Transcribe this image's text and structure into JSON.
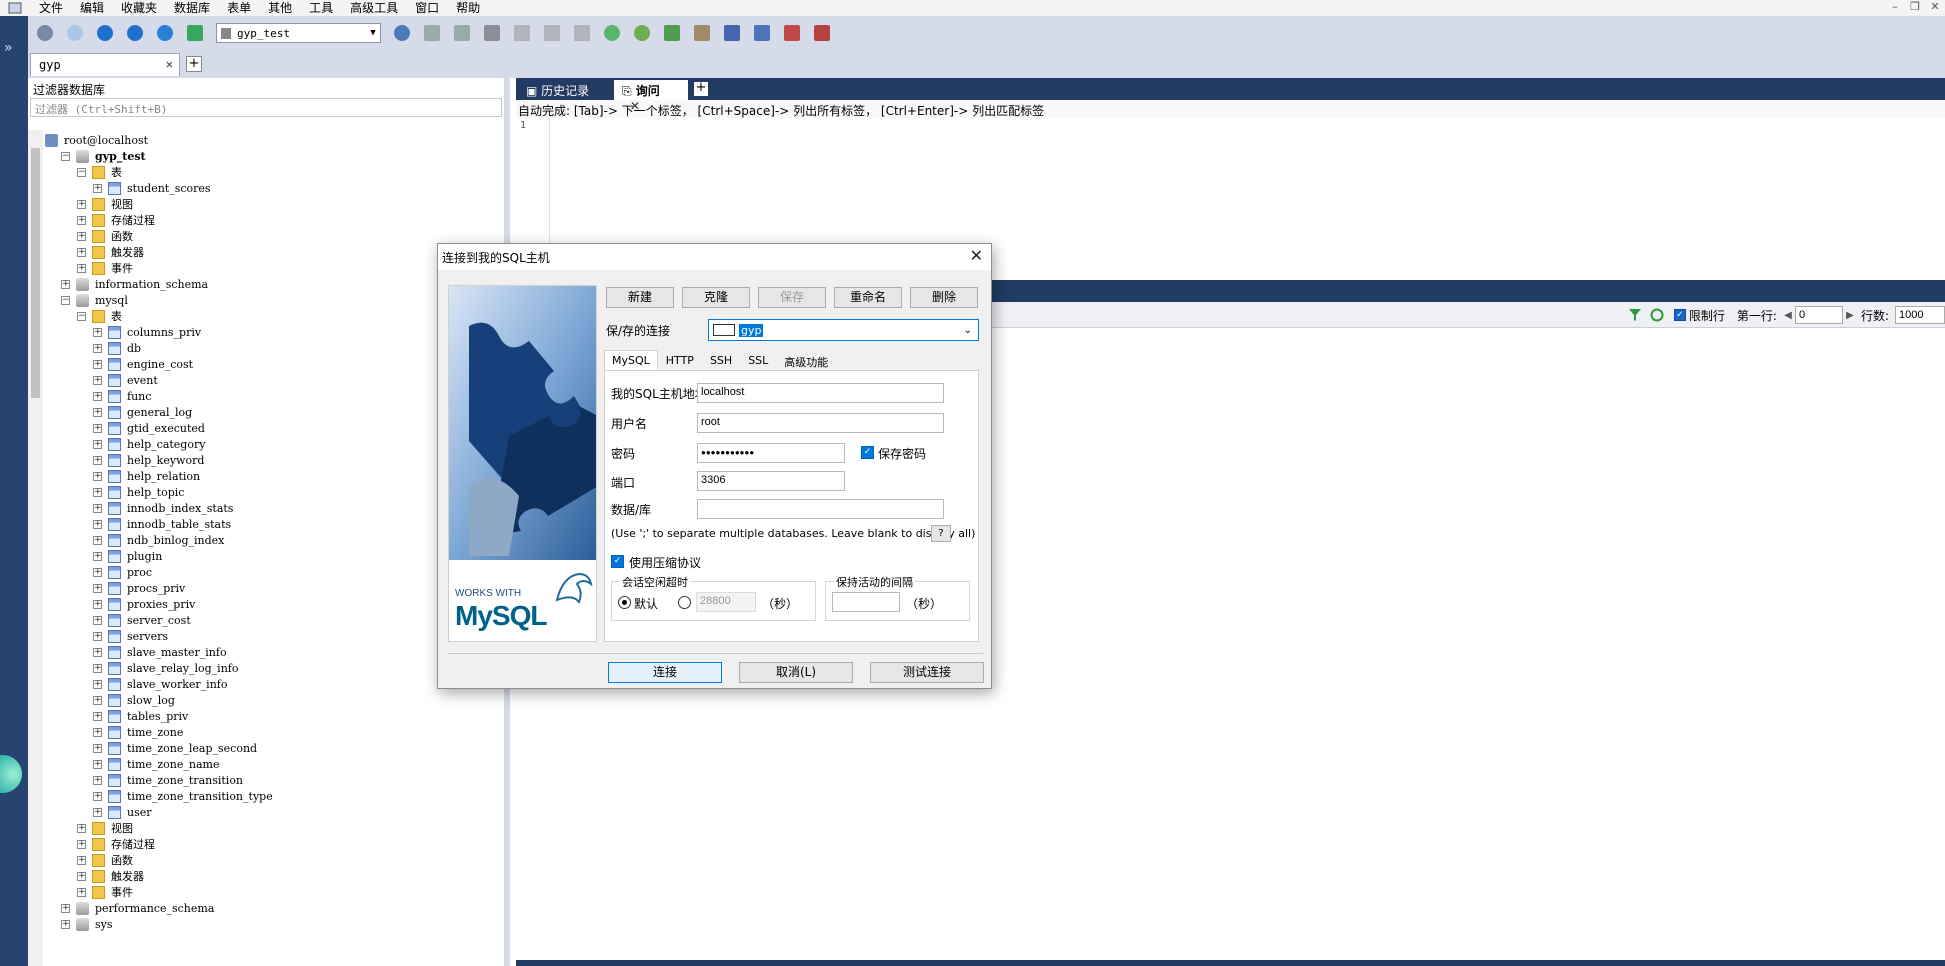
{
  "menu": [
    "文件",
    "编辑",
    "收藏夹",
    "数据库",
    "表单",
    "其他",
    "工具",
    "高级工具",
    "窗口",
    "帮助"
  ],
  "toolbar": {
    "db_select": "gyp_test"
  },
  "conn_tab": {
    "label": "gyp"
  },
  "left": {
    "filter_title": "过滤器数据库",
    "filter_placeholder": "过滤器 (Ctrl+Shift+B)",
    "tree": [
      {
        "level": 0,
        "exp": "",
        "icon": "srv",
        "label": "root@localhost"
      },
      {
        "level": 1,
        "exp": "−",
        "icon": "db",
        "label": "gyp_test",
        "bold": true
      },
      {
        "level": 2,
        "exp": "−",
        "icon": "folder",
        "label": "表"
      },
      {
        "level": 3,
        "exp": "+",
        "icon": "table",
        "label": "student_scores"
      },
      {
        "level": 2,
        "exp": "+",
        "icon": "folder",
        "label": "视图"
      },
      {
        "level": 2,
        "exp": "+",
        "icon": "folder",
        "label": "存储过程"
      },
      {
        "level": 2,
        "exp": "+",
        "icon": "folder",
        "label": "函数"
      },
      {
        "level": 2,
        "exp": "+",
        "icon": "folder",
        "label": "触发器"
      },
      {
        "level": 2,
        "exp": "+",
        "icon": "folder",
        "label": "事件"
      },
      {
        "level": 1,
        "exp": "+",
        "icon": "db",
        "label": "information_schema"
      },
      {
        "level": 1,
        "exp": "−",
        "icon": "db",
        "label": "mysql"
      },
      {
        "level": 2,
        "exp": "−",
        "icon": "folder",
        "label": "表"
      },
      {
        "level": 3,
        "exp": "+",
        "icon": "table",
        "label": "columns_priv"
      },
      {
        "level": 3,
        "exp": "+",
        "icon": "table",
        "label": "db"
      },
      {
        "level": 3,
        "exp": "+",
        "icon": "table",
        "label": "engine_cost"
      },
      {
        "level": 3,
        "exp": "+",
        "icon": "table",
        "label": "event"
      },
      {
        "level": 3,
        "exp": "+",
        "icon": "table",
        "label": "func"
      },
      {
        "level": 3,
        "exp": "+",
        "icon": "table",
        "label": "general_log"
      },
      {
        "level": 3,
        "exp": "+",
        "icon": "table",
        "label": "gtid_executed"
      },
      {
        "level": 3,
        "exp": "+",
        "icon": "table",
        "label": "help_category"
      },
      {
        "level": 3,
        "exp": "+",
        "icon": "table",
        "label": "help_keyword"
      },
      {
        "level": 3,
        "exp": "+",
        "icon": "table",
        "label": "help_relation"
      },
      {
        "level": 3,
        "exp": "+",
        "icon": "table",
        "label": "help_topic"
      },
      {
        "level": 3,
        "exp": "+",
        "icon": "table",
        "label": "innodb_index_stats"
      },
      {
        "level": 3,
        "exp": "+",
        "icon": "table",
        "label": "innodb_table_stats"
      },
      {
        "level": 3,
        "exp": "+",
        "icon": "table",
        "label": "ndb_binlog_index"
      },
      {
        "level": 3,
        "exp": "+",
        "icon": "table",
        "label": "plugin"
      },
      {
        "level": 3,
        "exp": "+",
        "icon": "table",
        "label": "proc"
      },
      {
        "level": 3,
        "exp": "+",
        "icon": "table",
        "label": "procs_priv"
      },
      {
        "level": 3,
        "exp": "+",
        "icon": "table",
        "label": "proxies_priv"
      },
      {
        "level": 3,
        "exp": "+",
        "icon": "table",
        "label": "server_cost"
      },
      {
        "level": 3,
        "exp": "+",
        "icon": "table",
        "label": "servers"
      },
      {
        "level": 3,
        "exp": "+",
        "icon": "table",
        "label": "slave_master_info"
      },
      {
        "level": 3,
        "exp": "+",
        "icon": "table",
        "label": "slave_relay_log_info"
      },
      {
        "level": 3,
        "exp": "+",
        "icon": "table",
        "label": "slave_worker_info"
      },
      {
        "level": 3,
        "exp": "+",
        "icon": "table",
        "label": "slow_log"
      },
      {
        "level": 3,
        "exp": "+",
        "icon": "table",
        "label": "tables_priv"
      },
      {
        "level": 3,
        "exp": "+",
        "icon": "table",
        "label": "time_zone"
      },
      {
        "level": 3,
        "exp": "+",
        "icon": "table",
        "label": "time_zone_leap_second"
      },
      {
        "level": 3,
        "exp": "+",
        "icon": "table",
        "label": "time_zone_name"
      },
      {
        "level": 3,
        "exp": "+",
        "icon": "table",
        "label": "time_zone_transition"
      },
      {
        "level": 3,
        "exp": "+",
        "icon": "table",
        "label": "time_zone_transition_type"
      },
      {
        "level": 3,
        "exp": "+",
        "icon": "table",
        "label": "user"
      },
      {
        "level": 2,
        "exp": "+",
        "icon": "folder",
        "label": "视图"
      },
      {
        "level": 2,
        "exp": "+",
        "icon": "folder",
        "label": "存储过程"
      },
      {
        "level": 2,
        "exp": "+",
        "icon": "folder",
        "label": "函数"
      },
      {
        "level": 2,
        "exp": "+",
        "icon": "folder",
        "label": "触发器"
      },
      {
        "level": 2,
        "exp": "+",
        "icon": "folder",
        "label": "事件"
      },
      {
        "level": 1,
        "exp": "+",
        "icon": "db",
        "label": "performance_schema"
      },
      {
        "level": 1,
        "exp": "+",
        "icon": "db",
        "label": "sys"
      }
    ]
  },
  "query": {
    "tab_history": "历史记录",
    "tab_query": "询问",
    "hint": "自动完成:  [Tab]-> 下一个标签，  [Ctrl+Space]-> 列出所有标签，  [Ctrl+Enter]-> 列出匹配标签",
    "line1": "1"
  },
  "results": {
    "limit_label": "限制行",
    "first_row_label": "第一行:",
    "first_row_value": "0",
    "rows_label": "行数:",
    "rows_value": "1000"
  },
  "dialog": {
    "title": "连接到我的SQL主机",
    "banner_text1": "WORKS WITH",
    "banner_text2": "MySQL",
    "btn_new": "新建",
    "btn_clone": "克隆",
    "btn_save": "保存",
    "btn_rename": "重命名",
    "btn_delete": "删除",
    "saved_label": "保/存的连接",
    "saved_value": "gyp",
    "tabs": [
      "MySQL",
      "HTTP",
      "SSH",
      "SSL",
      "高级功能"
    ],
    "host_label": "我的SQL主机地址",
    "host_value": "localhost",
    "user_label": "用户名",
    "user_value": "root",
    "pwd_label": "密码",
    "pwd_value": "●●●●●●●●●●●",
    "save_pwd_label": "保存密码",
    "port_label": "端口",
    "port_value": "3306",
    "db_label": "数据/库",
    "db_value": "",
    "db_hint": "(Use ';' to separate multiple databases. Leave blank to display all)",
    "help_btn": "?",
    "compress_label": "使用压缩协议",
    "timeout_caption": "会话空闲超时",
    "default_label": "默认",
    "timeout_value": "28800",
    "sec_unit": "（秒）",
    "keepalive_caption": "保持活动的间隔",
    "keepalive_value": "",
    "btn_connect": "连接",
    "btn_cancel": "取消(L)",
    "btn_test": "测试连接"
  }
}
